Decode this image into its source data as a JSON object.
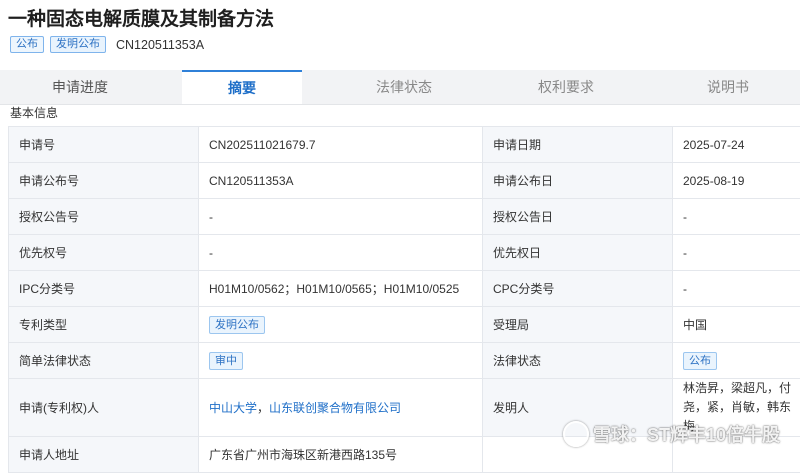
{
  "title": "一种固态电解质膜及其制备方法",
  "tags": [
    "公布",
    "发明公布"
  ],
  "pub_number": "CN120511353A",
  "tabs": [
    "申请进度",
    "摘要",
    "法律状态",
    "权利要求",
    "说明书"
  ],
  "section_title": "基本信息",
  "rows": [
    {
      "l1": "申请号",
      "v1": "CN202511021679.7",
      "l2": "申请日期",
      "v2": "2025-07-24"
    },
    {
      "l1": "申请公布号",
      "v1": "CN120511353A",
      "l2": "申请公布日",
      "v2": "2025-08-19"
    },
    {
      "l1": "授权公告号",
      "v1": "-",
      "l2": "授权公告日",
      "v2": "-"
    },
    {
      "l1": "优先权号",
      "v1": "-",
      "l2": "优先权日",
      "v2": "-"
    },
    {
      "l1": "IPC分类号",
      "v1": "H01M10/0562；H01M10/0565；H01M10/0525",
      "l2": "CPC分类号",
      "v2": "-"
    },
    {
      "l1": "专利类型",
      "v1": "发明公布",
      "l2": "受理局",
      "v2": "中国"
    },
    {
      "l1": "简单法律状态",
      "v1": "审中",
      "l2": "法律状态",
      "v2": "公布"
    },
    {
      "l1": "申请(专利权)人",
      "v1a": "中山大学",
      "v1sep": "，",
      "v1b": "山东联创聚合物有限公司",
      "l2": "发明人",
      "v2": "林浩昇，梁超凡，付尧，紧，肖敏，韩东梅"
    },
    {
      "l1": "申请人地址",
      "v1": "广东省广州市海珠区新港西路135号",
      "l2": "",
      "v2": ""
    }
  ],
  "watermark": "雪球：ST辉丰10倍牛股"
}
